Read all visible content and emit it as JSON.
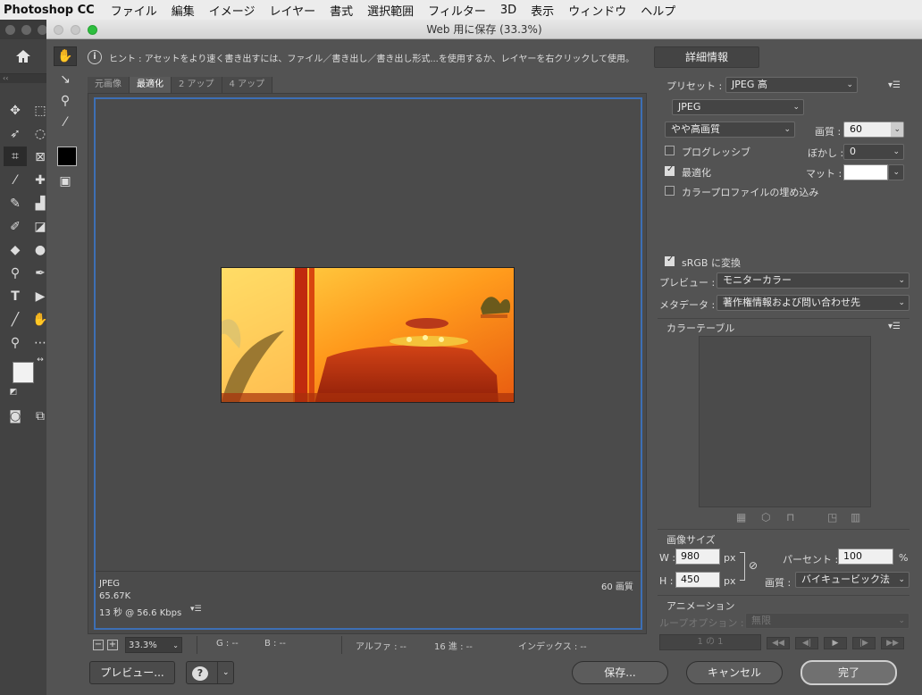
{
  "menubar": {
    "app": "Photoshop CC",
    "items": [
      "ファイル",
      "編集",
      "イメージ",
      "レイヤー",
      "書式",
      "選択範囲",
      "フィルター",
      "3D",
      "表示",
      "ウィンドウ",
      "ヘルプ"
    ]
  },
  "dialog": {
    "title": "Web 用に保存 (33.3%)",
    "hint": "ヒント : アセットをより速く書き出すには、ファイル／書き出し／書き出し形式...を使用するか、レイヤーを右クリックして使用。",
    "details_button": "詳細情報",
    "tabs": [
      "元画像",
      "最適化",
      "2 アップ",
      "4 アップ"
    ],
    "active_tab": 1,
    "preview": {
      "format": "JPEG",
      "size": "65.67K",
      "time": "13 秒 @ 56.6 Kbps",
      "quality_label": "60 画質"
    },
    "status": {
      "zoom": "33.3%",
      "g": "G : --",
      "b": "B : --",
      "alpha": "アルファ : --",
      "hex": "16 進 : --",
      "index": "インデックス : --"
    },
    "buttons": {
      "preview": "プレビュー...",
      "help": "?",
      "save": "保存...",
      "cancel": "キャンセル",
      "done": "完了"
    }
  },
  "settings": {
    "preset_label": "プリセット :",
    "preset_value": "JPEG 高",
    "format": "JPEG",
    "quality_preset": "やや高画質",
    "quality_label": "画質 :",
    "quality_value": "60",
    "progressive_label": "プログレッシブ",
    "progressive": false,
    "blur_label": "ぼかし :",
    "blur_value": "0",
    "optimize_label": "最適化",
    "optimize": true,
    "matte_label": "マット :",
    "embed_profile_label": "カラープロファイルの埋め込み",
    "embed_profile": false,
    "srgb_label": "sRGB に変換",
    "srgb": true,
    "preview_label": "プレビュー :",
    "preview_value": "モニターカラー",
    "metadata_label": "メタデータ :",
    "metadata_value": "著作権情報および問い合わせ先",
    "color_table_label": "カラーテーブル"
  },
  "image_size": {
    "header": "画像サイズ",
    "w_label": "W :",
    "w_value": "980",
    "h_label": "H :",
    "h_value": "450",
    "unit": "px",
    "percent_label": "パーセント :",
    "percent_value": "100",
    "percent_unit": "%",
    "quality_label": "画質 :",
    "quality_value": "バイキュービック法"
  },
  "animation": {
    "header": "アニメーション",
    "loop_label": "ループオプション :",
    "loop_value": "無限",
    "frame_counter": "1 の 1"
  },
  "colors": {
    "accent_frame": "#3d6fb5",
    "matte": "#ffffff",
    "green_light": "#2dbe3e"
  }
}
